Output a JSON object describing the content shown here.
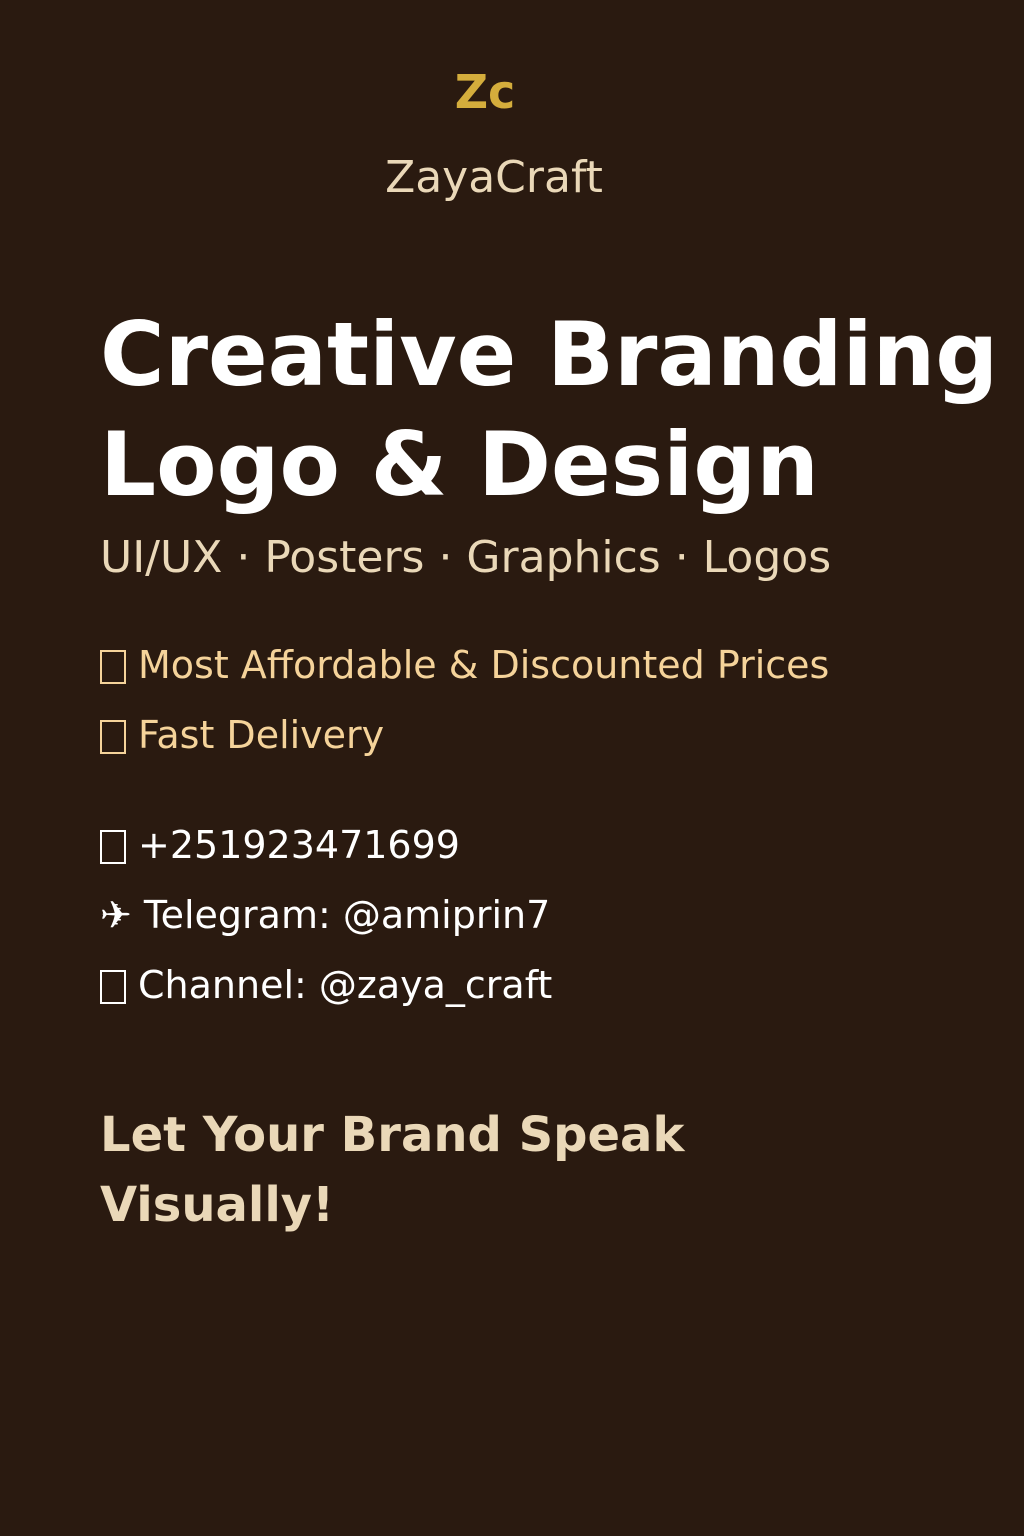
{
  "brand": {
    "mark": "Zc",
    "name": "ZayaCraft"
  },
  "headline": {
    "line1": "Creative Branding",
    "line2": "Logo & Design"
  },
  "services": "UI/UX · Posters · Graphics · Logos",
  "perks": [
    {
      "icon": "sparkle-icon",
      "text": "Most Affordable & Discounted Prices"
    },
    {
      "icon": "rocket-icon",
      "text": "Fast Delivery"
    }
  ],
  "contacts": [
    {
      "icon": "phone-icon",
      "text": "+251923471699"
    },
    {
      "icon": "telegram-icon",
      "symbol": "✈",
      "text": "Telegram: @amiprin7"
    },
    {
      "icon": "megaphone-icon",
      "text": "Channel: @zaya_craft"
    }
  ],
  "tagline": {
    "line1": "Let Your Brand Speak",
    "line2": "Visually!"
  },
  "colors": {
    "background": "#2a1a10",
    "gold": "#d4ad3c",
    "cream": "#ead8b8",
    "peach": "#f5d39a",
    "white": "#ffffff"
  }
}
